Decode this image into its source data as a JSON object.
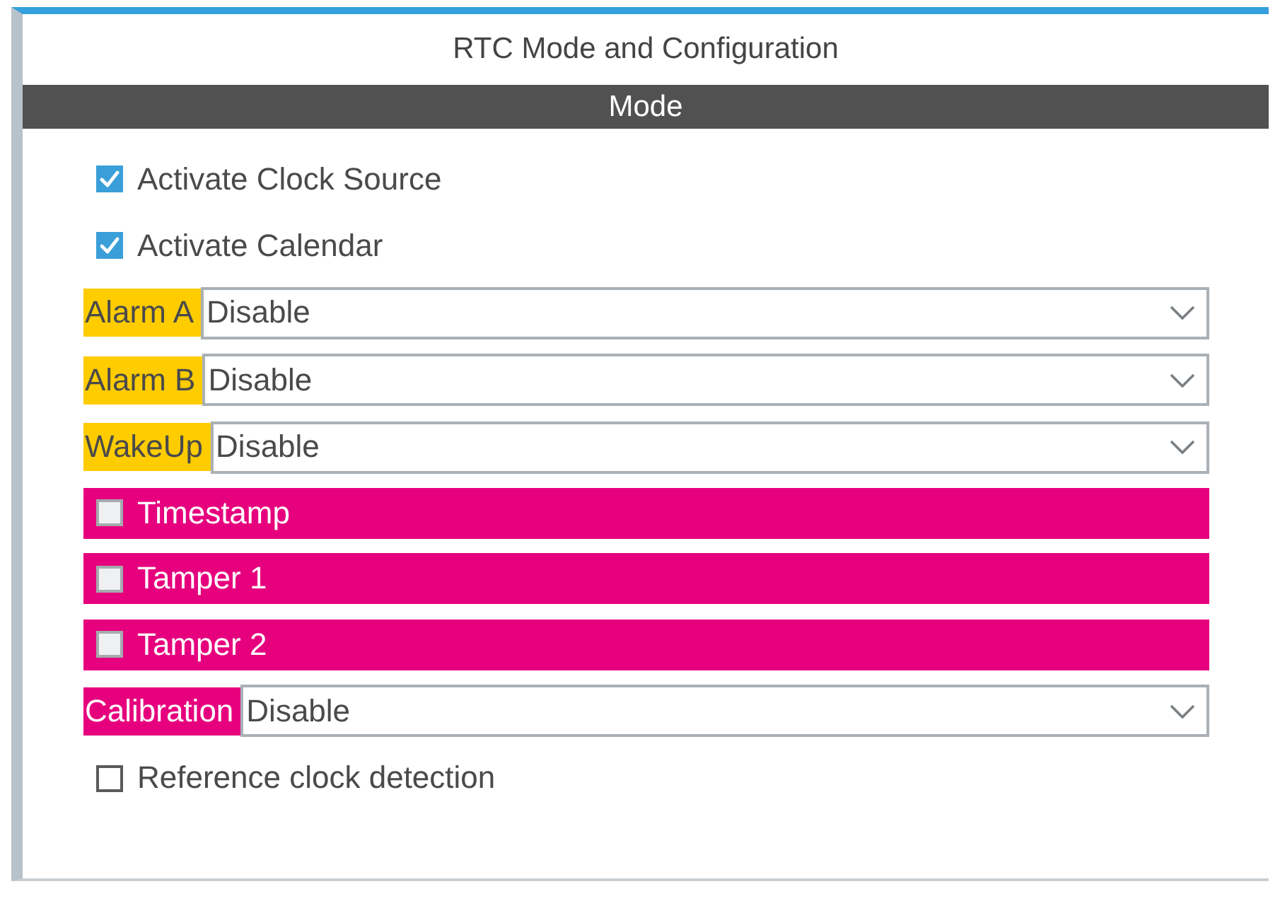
{
  "panel": {
    "title": "RTC Mode and Configuration",
    "section": "Mode"
  },
  "rows": [
    {
      "kind": "checkbox",
      "label": "Activate Clock Source",
      "checked": true
    },
    {
      "kind": "checkbox",
      "label": "Activate Calendar",
      "checked": true
    },
    {
      "kind": "select",
      "label": "Alarm A",
      "color": "#ffcc00",
      "value": "Disable"
    },
    {
      "kind": "select",
      "label": "Alarm B",
      "color": "#ffcc00",
      "value": "Disable"
    },
    {
      "kind": "select",
      "label": "WakeUp",
      "color": "#ffcc00",
      "value": "Disable"
    },
    {
      "kind": "bar",
      "label": "Timestamp",
      "color": "#e6007e",
      "checked": false
    },
    {
      "kind": "bar",
      "label": "Tamper 1",
      "color": "#e6007e",
      "checked": false
    },
    {
      "kind": "bar",
      "label": "Tamper 2",
      "color": "#e6007e",
      "checked": false
    },
    {
      "kind": "select",
      "label": "Calibration",
      "color": "#e6007e",
      "value": "Disable"
    },
    {
      "kind": "checkbox",
      "label": "Reference clock detection",
      "checked": false
    }
  ]
}
